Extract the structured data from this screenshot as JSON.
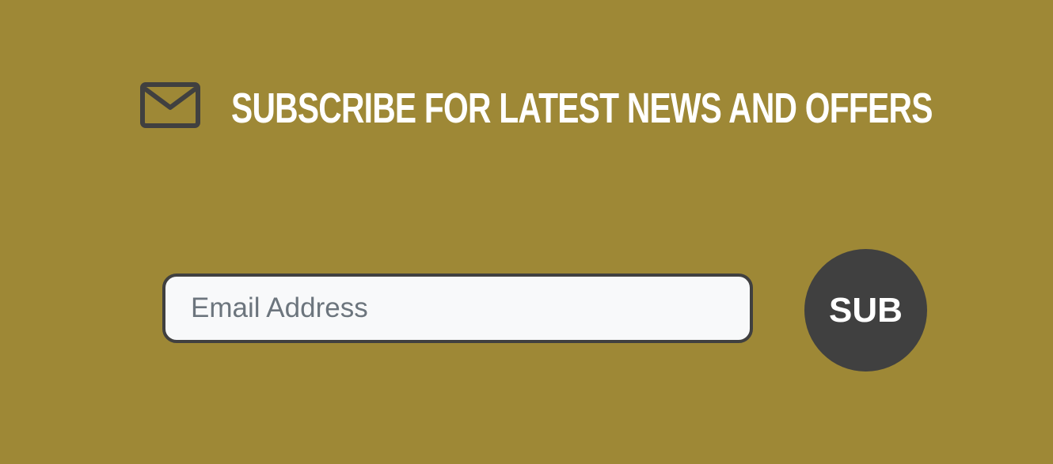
{
  "newsletter": {
    "icon": "envelope-icon",
    "heading": "SUBSCRIBE FOR LATEST NEWS AND OFFERS",
    "email_placeholder": "Email Address",
    "email_value": "",
    "submit_label": "SUB"
  },
  "colors": {
    "background": "#9e8836",
    "icon": "#404040",
    "heading_text": "#ffffff",
    "input_border": "#404040",
    "input_background": "#f8f9fa",
    "placeholder_text": "#6c757d",
    "button_background": "#404040",
    "button_text": "#ffffff"
  }
}
